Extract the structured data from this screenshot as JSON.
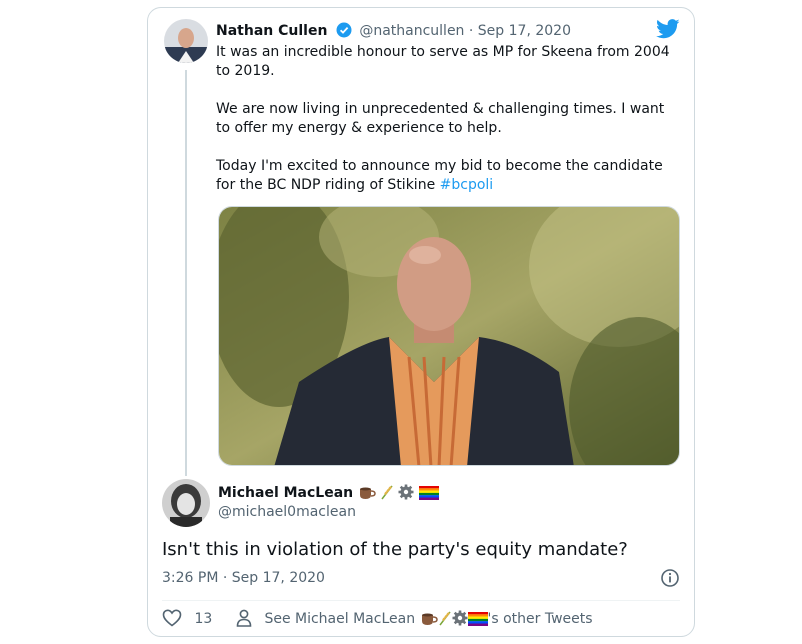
{
  "tweet": {
    "author_name": "Nathan Cullen",
    "author_handle": "@nathancullen",
    "separator": "·",
    "date": "Sep 17, 2020",
    "paragraphs": [
      "It was an incredible honour to serve as MP for Skeena from 2004 to 2019.",
      "We are now living in unprecedented & challenging times. I want to offer my energy & experience to help."
    ],
    "last_paragraph_text": "Today I'm excited to announce my bid to become the candidate for the BC NDP riding of Stikine ",
    "hashtag": "#bcpoli"
  },
  "reply": {
    "author_name": "Michael MacLean",
    "author_handle": "@michael0maclean",
    "text": "Isn't this in violation of the party's equity mandate?",
    "timestamp": "3:26 PM · Sep 17, 2020",
    "like_count": "13",
    "see_tweets_prefix": "See Michael MacLean",
    "see_tweets_suffix": "'s other Tweets",
    "name_emojis": [
      "coffee-emoji",
      "wheat-emoji",
      "gear-emoji",
      "rainbow-flag-emoji"
    ]
  },
  "colors": {
    "twitter_blue": "#1d9bf0",
    "text_primary": "#0f1419",
    "text_secondary": "#536471",
    "border": "#cfd9de"
  }
}
